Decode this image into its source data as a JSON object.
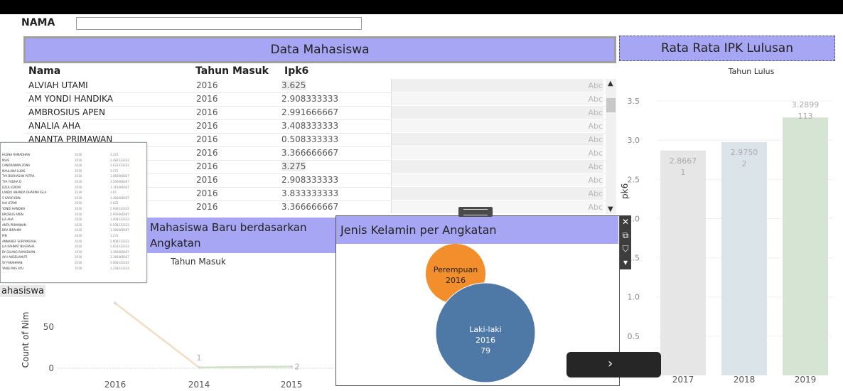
{
  "filter": {
    "label": "NAMA",
    "value": ""
  },
  "data_mahasiswa": {
    "title": "Data Mahasiswa",
    "columns": [
      "Nama",
      "Tahun Masuk",
      "Ipk6"
    ],
    "rows": [
      {
        "nama": "ALVIAH UTAMI",
        "tahun": "2016",
        "ipk": "3.625",
        "abc": "Abc"
      },
      {
        "nama": "AM YONDI HANDIKA",
        "tahun": "2016",
        "ipk": "2.908333333",
        "abc": "Abc"
      },
      {
        "nama": "AMBROSIUS APEN",
        "tahun": "2016",
        "ipk": "2.991666667",
        "abc": "Abc"
      },
      {
        "nama": "ANALIA AHA",
        "tahun": "2016",
        "ipk": "3.408333333",
        "abc": "Abc"
      },
      {
        "nama": "ANANTA PRIMAWAN",
        "tahun": "2016",
        "ipk": "0.508333333",
        "abc": "Abc"
      },
      {
        "nama": "",
        "tahun": "2016",
        "ipk": "3.366666667",
        "abc": "Abc"
      },
      {
        "nama": "",
        "tahun": "2016",
        "ipk": "3.275",
        "abc": "Abc"
      },
      {
        "nama": "",
        "tahun": "2016",
        "ipk": "2.908333333",
        "abc": "Abc"
      },
      {
        "nama": "",
        "tahun": "2016",
        "ipk": "3.833333333",
        "abc": "Abc"
      },
      {
        "nama": "",
        "tahun": "2016",
        "ipk": "3.366666667",
        "abc": "Abc"
      }
    ]
  },
  "thumbnail_rows": [
    [
      "HUSNA RAMADHAN",
      "2016",
      "3.225"
    ],
    [
      "MUIS",
      "2016",
      "3.483333333"
    ],
    [
      "CANDRAWAN ZONA",
      "2016",
      "3.633333333"
    ],
    [
      "MAULANA LUBIS",
      "2016",
      "3.575"
    ],
    [
      "TYA BURHASAN PUTRA",
      "2016",
      "3.066666667"
    ],
    [
      "TYA YUDHA D",
      "2016",
      "3.566666667"
    ],
    [
      "DZUL IGROM",
      "2016",
      "3.316666667"
    ],
    [
      "LANDO ANANDA DHARMA IGLA",
      "2016",
      "3.65"
    ],
    [
      "S SARIFUDIN",
      "2016",
      "1.466666667"
    ],
    [
      "IAH UTAMI",
      "2016",
      "3.625"
    ],
    [
      "YONDI HANDIKA",
      "2016",
      "2.908333333"
    ],
    [
      "BROSIUS APEN",
      "2016",
      "2.991666667"
    ],
    [
      "LIA AHA",
      "2016",
      "3.408333333"
    ],
    [
      "ANTA PRIMAWAN",
      "2016",
      "0.508333333"
    ],
    [
      "DRA IBRAHIM",
      "2016",
      "3.366666667"
    ],
    [
      "PIN",
      "2016",
      "3.275"
    ],
    [
      "ANNARIEF SURYANSYAH",
      "2016",
      "2.908333333"
    ],
    [
      "LIA RAHMAT NUGRAHA",
      "2016",
      "3.833333333"
    ],
    [
      "BY GILANG RAMADHAN",
      "2016",
      "3.366666667"
    ],
    [
      "AYU ANGELAMUTI",
      "2016",
      "3.366666667"
    ],
    [
      "SY FARAHMAN",
      "2016",
      "3.608333333"
    ],
    [
      "YANG MAS AYU",
      "2016",
      "3.258333333"
    ]
  ],
  "ipk_chart": {
    "title": "Rata Rata IPK Lulusan",
    "header": "Tahun Lulus",
    "ylabel": "pk6",
    "colors": [
      "#e6e6e6",
      "#dbe4e8",
      "#d5e4d3"
    ],
    "chart_data": {
      "type": "bar",
      "categories": [
        "2017",
        "2018",
        "2019"
      ],
      "values": [
        2.8667,
        2.975,
        3.2899
      ],
      "labels": [
        [
          "2.8667",
          "1"
        ],
        [
          "2.9750",
          "2"
        ],
        [
          "3.2899",
          "113"
        ]
      ],
      "ylim": [
        0,
        3.7
      ],
      "yticks": [
        "0.5",
        "1.0",
        "1.5",
        "2.0",
        "2.5",
        "3.0",
        "3.5"
      ],
      "ytick_values": [
        0.5,
        1.0,
        1.5,
        2.0,
        2.5,
        3.0,
        3.5
      ]
    }
  },
  "mahasiswa_baru": {
    "title": "Mahasiswa Baru berdasarkan Angkatan",
    "header": "Tahun Masuk",
    "tag": "ahasiswa",
    "ylabel": "Count of Nim",
    "chart_data": {
      "type": "line",
      "x": [
        "2016",
        "2014",
        "2015"
      ],
      "values": [
        79,
        1,
        2
      ],
      "labels": [
        "",
        "1",
        "2"
      ],
      "yticks": [
        "0",
        "50"
      ],
      "ytick_values": [
        0,
        50
      ]
    }
  },
  "jenis_kelamin": {
    "title": "Jenis Kelamin per Angkatan",
    "chart_data": {
      "type": "scatter",
      "bubbles": [
        {
          "gender": "Perempuan",
          "year": "2016",
          "count": "",
          "color": "#f28e2b"
        },
        {
          "gender": "Laki-laki",
          "year": "2016",
          "count": "79",
          "color": "#4e79a7"
        }
      ]
    }
  },
  "toolbar": {
    "close": "✕",
    "popout": "⧉",
    "filter": "⛉",
    "more": "▾"
  },
  "next_button": "›"
}
